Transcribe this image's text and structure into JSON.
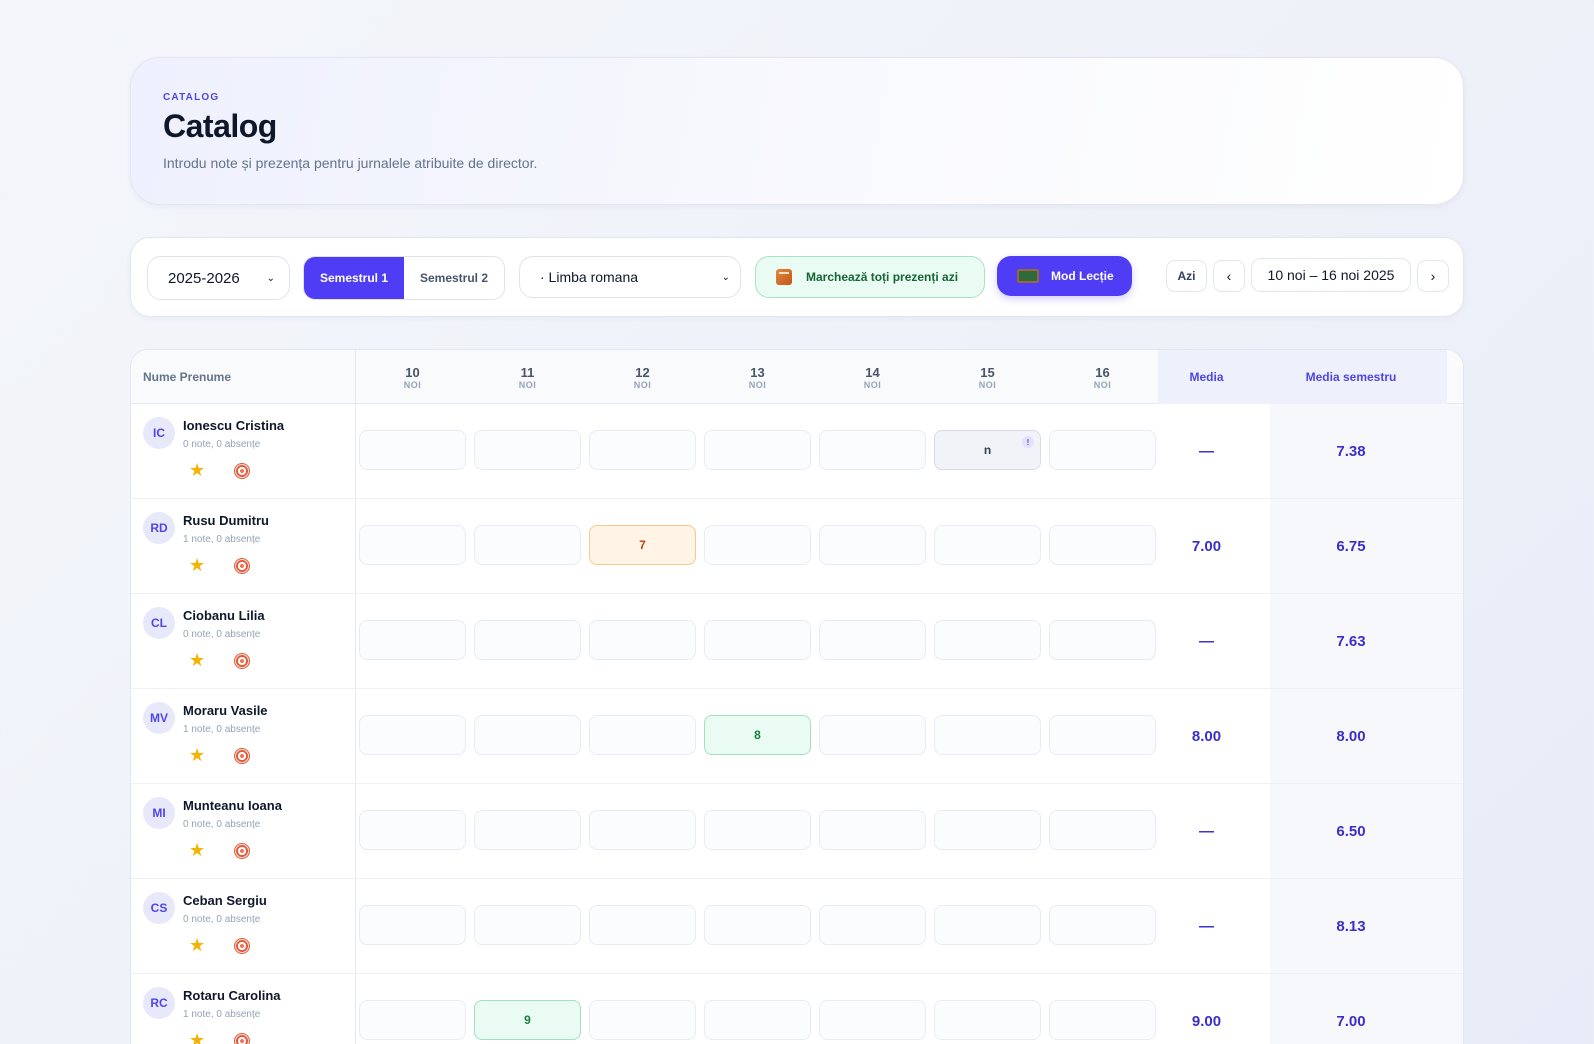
{
  "header": {
    "eyebrow": "CATALOG",
    "title": "Catalog",
    "subtitle": "Introdu note și prezența pentru jurnalele atribuite de director."
  },
  "toolbar": {
    "year": "2025-2026",
    "semester1": "Semestrul 1",
    "semester2": "Semestrul 2",
    "subject": "· Limba romana",
    "mark_present": "Marchează toți prezenți azi",
    "lesson_mode": "Mod Lecție",
    "today": "Azi",
    "date_range": "10 noi – 16 noi 2025",
    "prev_icon": "‹",
    "next_icon": "›",
    "select_chevron": "⌄"
  },
  "table": {
    "name_header": "Nume Prenume",
    "media_header": "Media",
    "media_semestru_header": "Media semestru",
    "days": [
      {
        "day": "10",
        "month": "NOI"
      },
      {
        "day": "11",
        "month": "NOI"
      },
      {
        "day": "12",
        "month": "NOI"
      },
      {
        "day": "13",
        "month": "NOI"
      },
      {
        "day": "14",
        "month": "NOI"
      },
      {
        "day": "15",
        "month": "NOI"
      },
      {
        "day": "16",
        "month": "NOI"
      }
    ],
    "rows": [
      {
        "initials": "IC",
        "name": "Ionescu Cristina",
        "stats": "0 note, 0 absențe",
        "cells": [
          "",
          "",
          "",
          "",
          "",
          "n",
          ""
        ],
        "media": "—",
        "media_semestru": "7.38"
      },
      {
        "initials": "RD",
        "name": "Rusu Dumitru",
        "stats": "1 note, 0 absențe",
        "cells": [
          "",
          "",
          "7",
          "",
          "",
          "",
          ""
        ],
        "media": "7.00",
        "media_semestru": "6.75"
      },
      {
        "initials": "CL",
        "name": "Ciobanu Lilia",
        "stats": "0 note, 0 absențe",
        "cells": [
          "",
          "",
          "",
          "",
          "",
          "",
          ""
        ],
        "media": "—",
        "media_semestru": "7.63"
      },
      {
        "initials": "MV",
        "name": "Moraru Vasile",
        "stats": "1 note, 0 absențe",
        "cells": [
          "",
          "",
          "",
          "8",
          "",
          "",
          ""
        ],
        "media": "8.00",
        "media_semestru": "8.00"
      },
      {
        "initials": "MI",
        "name": "Munteanu Ioana",
        "stats": "0 note, 0 absențe",
        "cells": [
          "",
          "",
          "",
          "",
          "",
          "",
          ""
        ],
        "media": "—",
        "media_semestru": "6.50"
      },
      {
        "initials": "CS",
        "name": "Ceban Sergiu",
        "stats": "0 note, 0 absențe",
        "cells": [
          "",
          "",
          "",
          "",
          "",
          "",
          ""
        ],
        "media": "—",
        "media_semestru": "8.13"
      },
      {
        "initials": "RC",
        "name": "Rotaru Carolina",
        "stats": "1 note, 0 absențe",
        "cells": [
          "",
          "9",
          "",
          "",
          "",
          "",
          ""
        ],
        "media": "9.00",
        "media_semestru": "7.00"
      }
    ]
  },
  "colors": {
    "accent": "#4f3df5",
    "grade_low": "#c2410c",
    "grade_good": "#15803d"
  },
  "icons": {
    "flag": "!",
    "star": "★"
  }
}
